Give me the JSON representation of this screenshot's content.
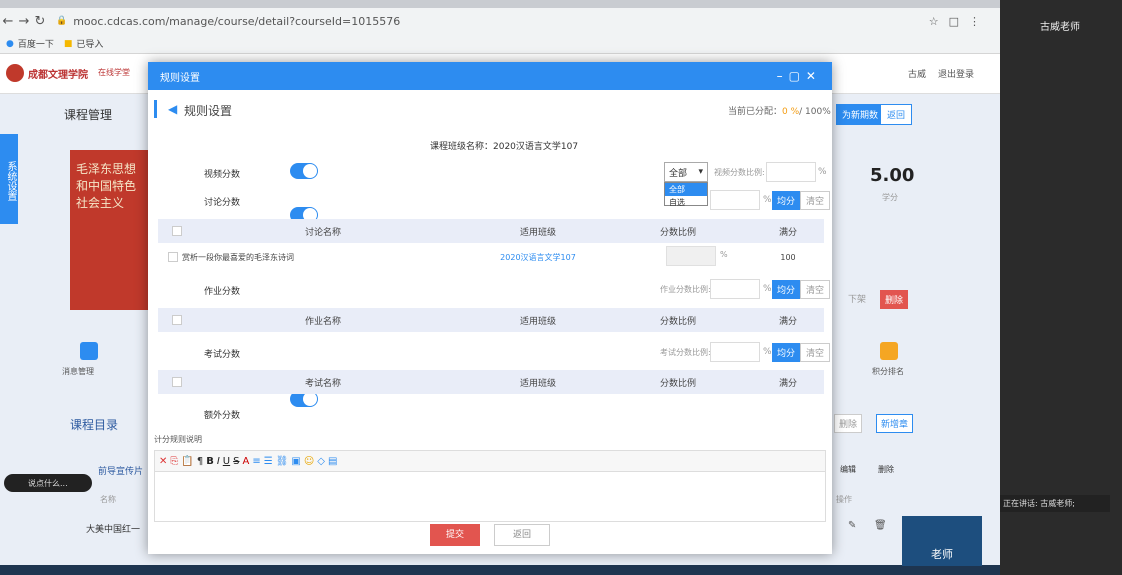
{
  "browser": {
    "url": "mooc.cdcas.com/manage/course/detail?courseId=1015576",
    "bookmarks": [
      "百度一下",
      "已导入"
    ]
  },
  "right_panel": {
    "teacher_name": "古威老师",
    "speaking": "正在讲话: 古威老师;",
    "avatar_label": "老师"
  },
  "site": {
    "logo_text": "成都文理学院",
    "logo_sub": "在线学堂",
    "user": "古威",
    "logout": "退出登录",
    "page_title": "课程管理",
    "side_tab": "系统设置",
    "new_term_btn": "为新期数",
    "back_btn": "返回",
    "score": "5.00",
    "score_label": "学分",
    "course_cover_text": "毛泽东思想和中国特色社会主义",
    "msg_mgmt": "消息管理",
    "rank": "积分排名",
    "catalog_tab": "课程目录",
    "intro": "前导宣传片",
    "name_col": "名称",
    "op_col": "操作",
    "row_name": "大美中国红一",
    "edit": "编辑",
    "delete": "删除",
    "new_chapter": "新增章",
    "del_btn": "删除",
    "offline_btn": "下架",
    "chat_placeholder": "说点什么..."
  },
  "modal": {
    "title": "规则设置",
    "heading": "规则设置",
    "allocated_label": "当前已分配：",
    "allocated_value": "0 %",
    "allocated_total": "/ 100%",
    "class_name": "课程班级名称：2020汉语言文学107",
    "video": {
      "label": "视频分数",
      "select": "全部",
      "options": [
        "全部",
        "自选"
      ],
      "ratio_label": "视频分数比例:",
      "unit": "%"
    },
    "discuss": {
      "label": "讨论分数",
      "unit": "%",
      "avg": "均分",
      "clear": "清空",
      "headers": [
        "讨论名称",
        "适用班级",
        "分数比例",
        "满分"
      ],
      "row": {
        "name": "赏析一段你最喜爱的毛泽东诗词",
        "class": "2020汉语言文学107",
        "ratio_unit": "%",
        "full": "100"
      }
    },
    "homework": {
      "label": "作业分数",
      "ratio_label": "作业分数比例:",
      "unit": "%",
      "avg": "均分",
      "clear": "清空",
      "headers": [
        "作业名称",
        "适用班级",
        "分数比例",
        "满分"
      ]
    },
    "exam": {
      "label": "考试分数",
      "ratio_label": "考试分数比例:",
      "unit": "%",
      "avg": "均分",
      "clear": "清空",
      "headers": [
        "考试名称",
        "适用班级",
        "分数比例",
        "满分"
      ]
    },
    "extra": {
      "label": "额外分数"
    },
    "rule_desc_label": "计分规则说明",
    "submit": "提交",
    "back": "返回"
  },
  "colors": {
    "accent": "#2d8cf0",
    "danger": "#e2554f"
  }
}
